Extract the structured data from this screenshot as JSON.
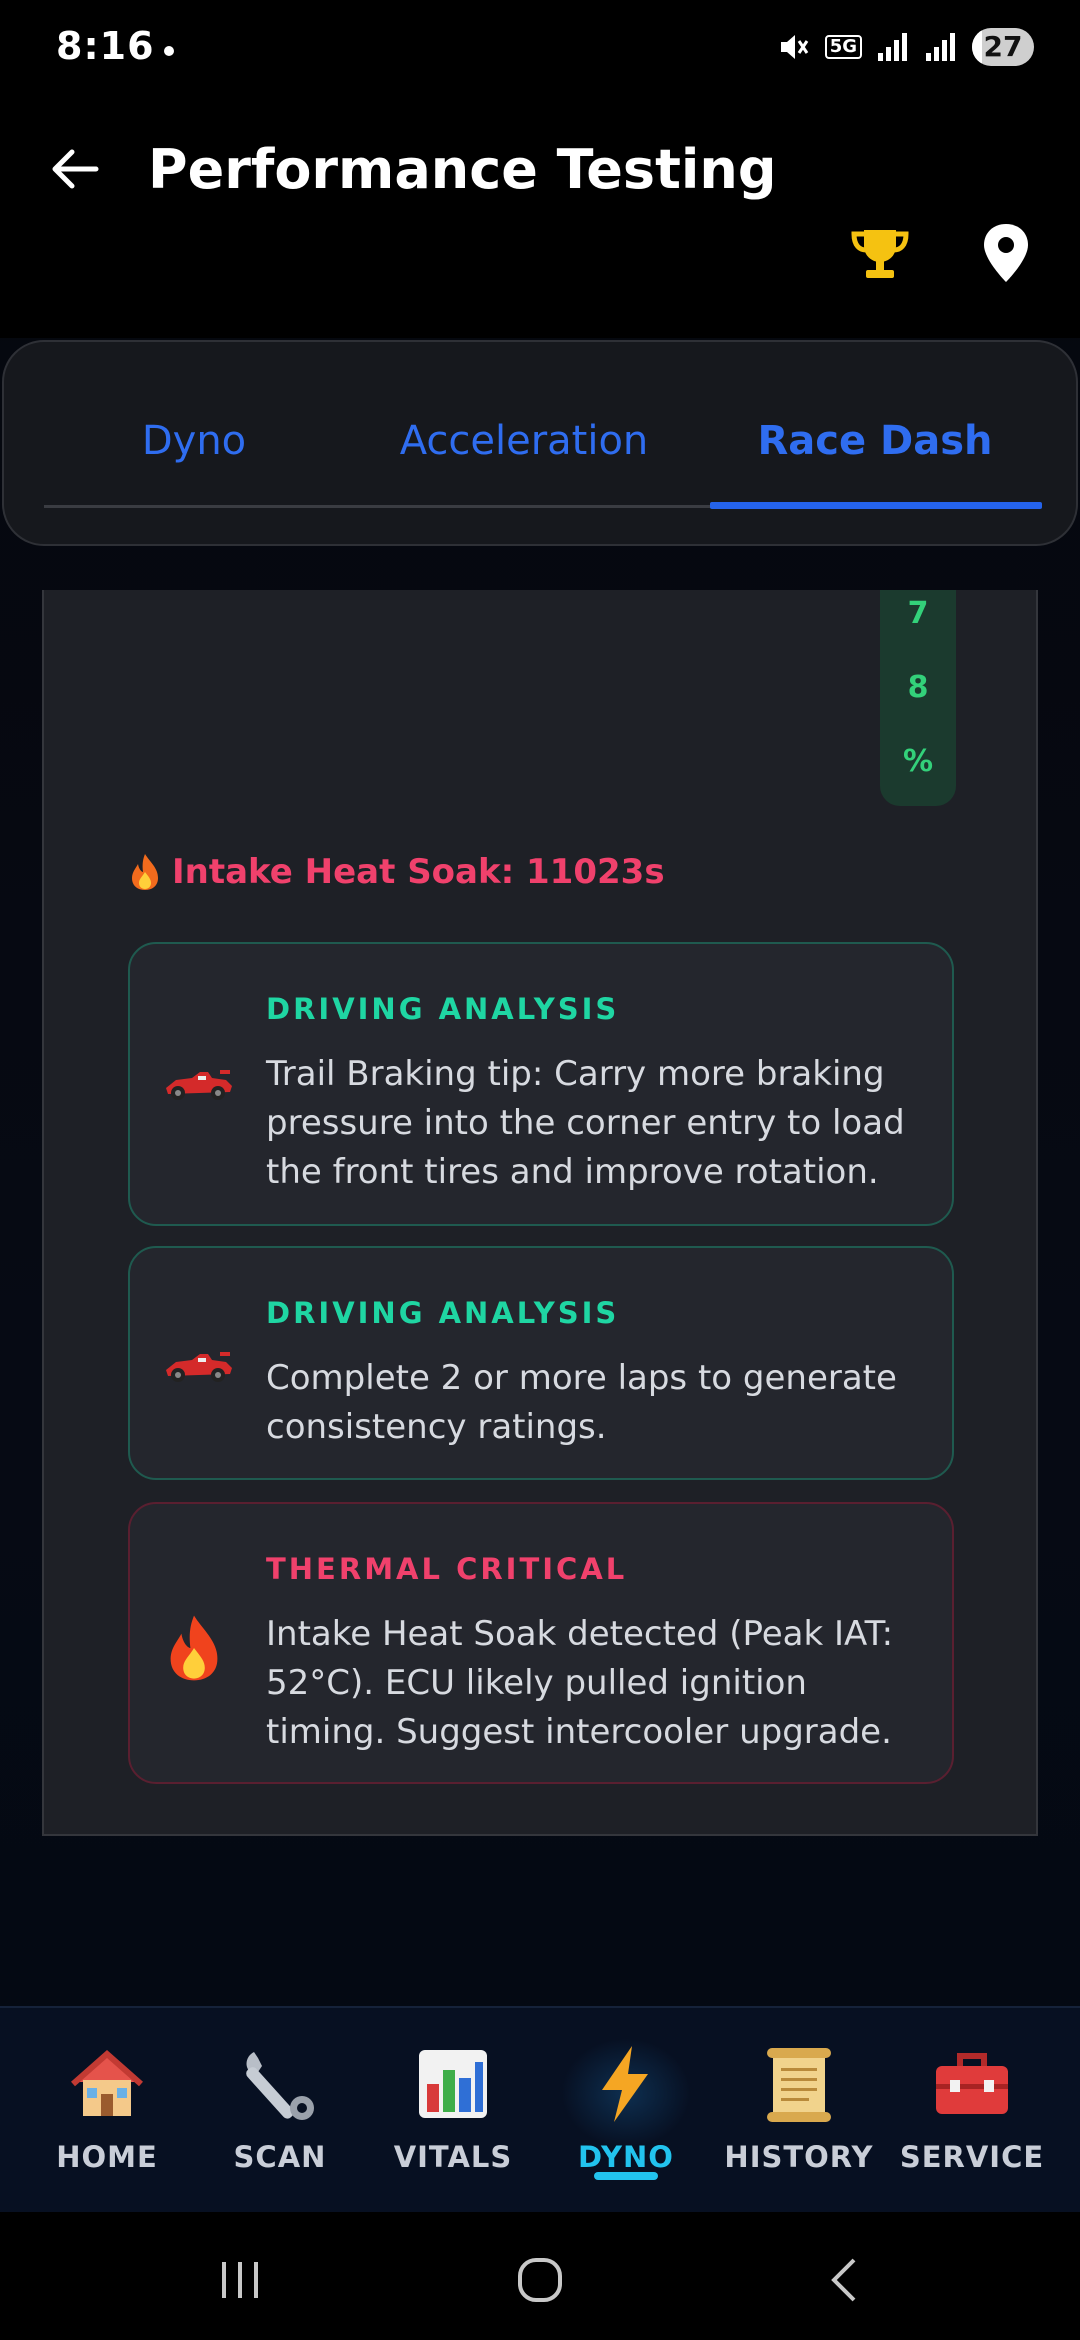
{
  "status_bar": {
    "time": "8:16",
    "network": "5G",
    "battery": "27"
  },
  "header": {
    "title": "Performance Testing"
  },
  "tabs": [
    {
      "label": "Dyno",
      "active": false
    },
    {
      "label": "Acceleration",
      "active": false
    },
    {
      "label": "Race Dash",
      "active": true
    }
  ],
  "panel": {
    "percent_chars": [
      "7",
      "8",
      "%"
    ],
    "heat_soak": "Intake Heat Soak: 11023s",
    "cards": [
      {
        "icon": "race-car-icon",
        "title": "DRIVING ANALYSIS",
        "text": "Trail Braking tip: Carry more braking pressure into the corner entry to load the front tires and improve rotation.",
        "accent": "#1fd6a3"
      },
      {
        "icon": "race-car-icon",
        "title": "DRIVING ANALYSIS",
        "text": "Complete 2 or more laps to generate consistency ratings.",
        "accent": "#1fd6a3"
      },
      {
        "icon": "fire-icon",
        "title": "THERMAL CRITICAL",
        "text": "Intake Heat Soak detected (Peak IAT: 52°C). ECU likely pulled ignition timing. Suggest intercooler upgrade.",
        "accent": "#f0416c"
      }
    ]
  },
  "bottom_nav": [
    {
      "label": "HOME",
      "icon": "house-icon",
      "active": false
    },
    {
      "label": "SCAN",
      "icon": "wrench-icon",
      "active": false
    },
    {
      "label": "VITALS",
      "icon": "bar-chart-icon",
      "active": false
    },
    {
      "label": "DYNO",
      "icon": "lightning-icon",
      "active": true
    },
    {
      "label": "HISTORY",
      "icon": "scroll-icon",
      "active": false
    },
    {
      "label": "SERVICE",
      "icon": "toolbox-icon",
      "active": false
    }
  ],
  "colors": {
    "accent": "#2563eb",
    "teal": "#1fd6a3",
    "critical": "#f0416c",
    "active_nav": "#22c3ee"
  }
}
